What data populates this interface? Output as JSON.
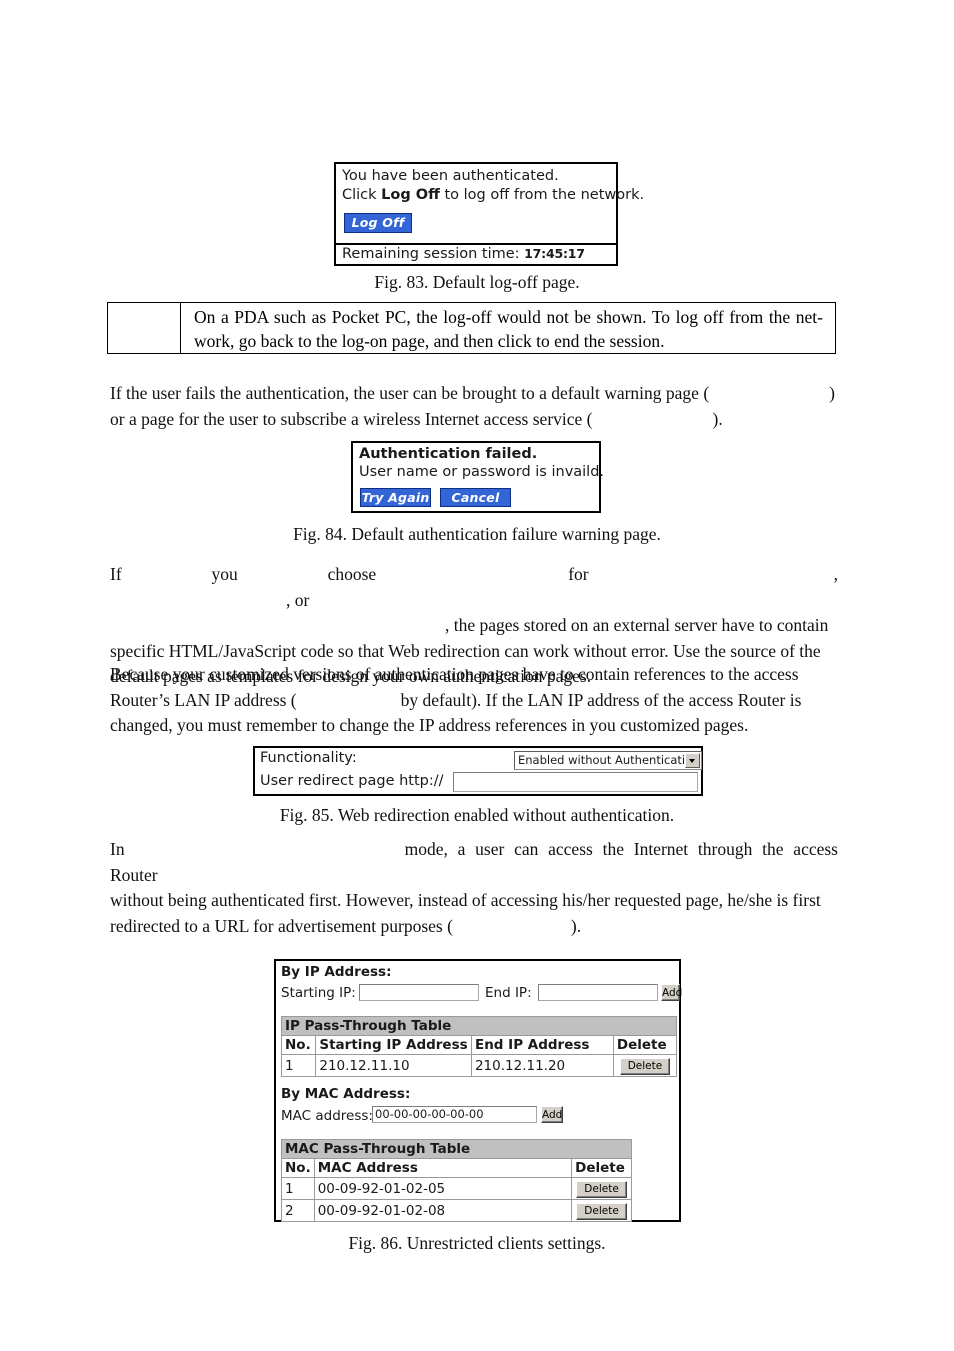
{
  "figures": {
    "logoff": {
      "line1": "You have been authenticated.",
      "line2_pre": "Click ",
      "line2_bold": "Log Off",
      "line2_post": " to log off from the network.",
      "button_label": "Log Off",
      "remaining_label": "Remaining session time:",
      "remaining_time": "17:45:17",
      "caption": "Fig. 83. Default log-off page."
    },
    "auth_failed": {
      "line1": "Authentication failed.",
      "line2": "User name or password is invaild.",
      "try_again_label": "Try Again",
      "cancel_label": "Cancel",
      "caption": "Fig. 84. Default authentication failure warning page."
    },
    "web_redirection": {
      "functionality_label": "Functionality:",
      "functionality_value": "Enabled without Authentication",
      "redirect_label": "User redirect page http://",
      "redirect_value": "",
      "caption": "Fig. 85. Web redirection enabled without authentication."
    },
    "unrestricted_clients": {
      "by_ip_title": "By IP Address:",
      "starting_ip_label": "Starting IP:",
      "starting_ip_value": "",
      "end_ip_label": "End IP:",
      "end_ip_value": "",
      "ip_add_label": "Add",
      "ip_table": {
        "title": "IP Pass-Through Table",
        "columns": [
          "No.",
          "Starting IP Address",
          "End IP Address",
          "Delete"
        ],
        "rows": [
          {
            "no": "1",
            "start_ip": "210.12.11.10",
            "end_ip": "210.12.11.20",
            "delete_label": "Delete"
          }
        ]
      },
      "by_mac_title": "By MAC Address:",
      "mac_label": "MAC address:",
      "mac_value": "00-00-00-00-00-00",
      "mac_add_label": "Add",
      "mac_table": {
        "title": "MAC Pass-Through Table",
        "columns": [
          "No.",
          "MAC Address",
          "Delete"
        ],
        "rows": [
          {
            "no": "1",
            "mac": "00-09-92-01-02-05",
            "delete_label": "Delete"
          },
          {
            "no": "2",
            "mac": "00-09-92-01-02-08",
            "delete_label": "Delete"
          }
        ]
      },
      "caption": "Fig. 86. Unrestricted clients settings."
    }
  },
  "note": {
    "text": "On a PDA such as Pocket PC, the log-off would not be shown. To log off from the net-work, go back to the log-on page, and then click           to end the session."
  },
  "paragraphs": {
    "p1_line1": "If the user fails the authentication, the user can be brought to a default warning page (",
    "p1_line1_end": ")",
    "p1_line2": "or a page for the user to subscribe a wireless Internet access service (",
    "p1_line2_end": ").",
    "p2_a": "If you choose",
    "p2_b": "for",
    "p2_c": ",",
    "p2_d": ", or",
    "p2_e": ", the pages stored on an external server have to contain",
    "p2_f": "specific HTML/JavaScript code so that Web redirection can work without error. Use the source of the",
    "p2_g": "default pages as templates for design your own authentication pages.",
    "p3_line1": "Because your customized versions of authentication pages have to contain references to the access",
    "p3_line2a": "Router’s LAN IP address (",
    "p3_line2b": "by default). If the LAN IP address of the access Router is",
    "p3_line3": "changed, you must remember to change the IP address references in you customized pages.",
    "p4_a": "In",
    "p4_b": "mode, a user can access the Internet through the access Router",
    "p4_c": "without being authenticated first. However, instead of accessing his/her requested page, he/she is first",
    "p4_d": "redirected to a URL for advertisement purposes (",
    "p4_e": ")."
  }
}
